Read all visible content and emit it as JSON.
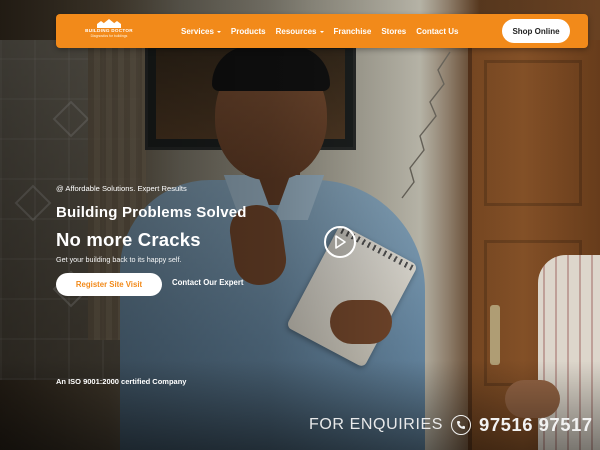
{
  "nav": {
    "logo": {
      "name": "BUILDING DOCTOR",
      "tagline": "Diagnostics for buildings"
    },
    "menu": [
      {
        "label": "Services",
        "has_dropdown": true
      },
      {
        "label": "Products",
        "has_dropdown": false
      },
      {
        "label": "Resources",
        "has_dropdown": true
      },
      {
        "label": "Franchise",
        "has_dropdown": false
      },
      {
        "label": "Stores",
        "has_dropdown": false
      },
      {
        "label": "Contact Us",
        "has_dropdown": false
      }
    ],
    "shop_button": "Shop Online"
  },
  "hero": {
    "tagline": "@ Affordable Solutions. Expert Results",
    "headline_1": "Building Problems Solved",
    "headline_2": "No more Cracks",
    "subtext": "Get your building back to its happy self.",
    "register_button": "Register Site Visit",
    "contact_link": "Contact Our Expert",
    "certification": "An ISO 9001:2000 certified Company"
  },
  "enquiry": {
    "label": "FOR ENQUIRIES",
    "phone": "97516 97517"
  },
  "colors": {
    "brand_orange": "#f28a1a",
    "button_white": "#ffffff"
  },
  "icons": [
    "logo-house-icon",
    "chevron-down-icon",
    "play-icon",
    "phone-icon"
  ]
}
